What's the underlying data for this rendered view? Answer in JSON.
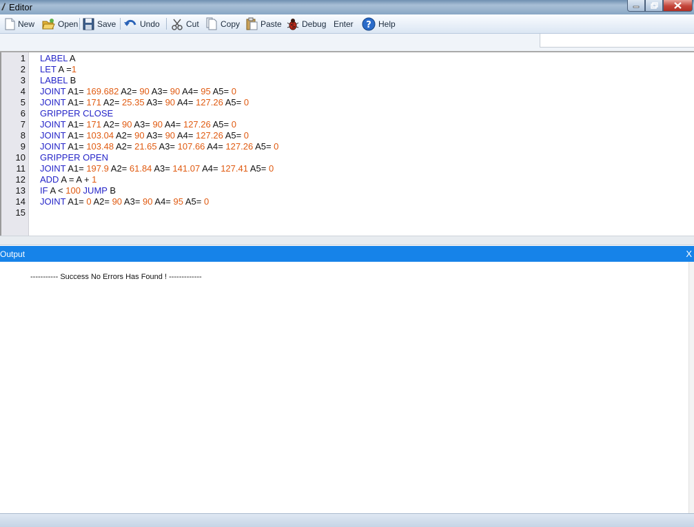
{
  "window": {
    "title": "Editor"
  },
  "toolbar": {
    "new": "New",
    "open": "Open",
    "save": "Save",
    "undo": "Undo",
    "cut": "Cut",
    "copy": "Copy",
    "paste": "Paste",
    "debug": "Debug",
    "enter": "Enter",
    "help": "Help"
  },
  "colors": {
    "keyword": "#2424c8",
    "number": "#e05a10",
    "output_header": "#1683e9"
  },
  "editor": {
    "lines": [
      [
        [
          "kw",
          "LABEL "
        ],
        [
          "t",
          "A"
        ]
      ],
      [
        [
          "kw",
          "LET "
        ],
        [
          "t",
          "A ="
        ],
        [
          "num",
          "1"
        ]
      ],
      [
        [
          "kw",
          "LABEL "
        ],
        [
          "t",
          "B"
        ]
      ],
      [
        [
          "kw",
          "JOINT "
        ],
        [
          "t",
          "A1= "
        ],
        [
          "num",
          "169.682"
        ],
        [
          "t",
          " A2= "
        ],
        [
          "num",
          "90"
        ],
        [
          "t",
          " A3= "
        ],
        [
          "num",
          "90"
        ],
        [
          "t",
          " A4= "
        ],
        [
          "num",
          "95"
        ],
        [
          "t",
          " A5= "
        ],
        [
          "num",
          "0"
        ]
      ],
      [
        [
          "kw",
          "JOINT "
        ],
        [
          "t",
          "A1= "
        ],
        [
          "num",
          "171"
        ],
        [
          "t",
          " A2= "
        ],
        [
          "num",
          "25.35"
        ],
        [
          "t",
          " A3= "
        ],
        [
          "num",
          "90"
        ],
        [
          "t",
          " A4= "
        ],
        [
          "num",
          "127.26"
        ],
        [
          "t",
          " A5= "
        ],
        [
          "num",
          "0"
        ]
      ],
      [
        [
          "kw",
          "GRIPPER CLOSE"
        ]
      ],
      [
        [
          "kw",
          "JOINT "
        ],
        [
          "t",
          "A1= "
        ],
        [
          "num",
          "171"
        ],
        [
          "t",
          " A2= "
        ],
        [
          "num",
          "90"
        ],
        [
          "t",
          " A3= "
        ],
        [
          "num",
          "90"
        ],
        [
          "t",
          " A4= "
        ],
        [
          "num",
          "127.26"
        ],
        [
          "t",
          " A5= "
        ],
        [
          "num",
          "0"
        ]
      ],
      [
        [
          "kw",
          "JOINT "
        ],
        [
          "t",
          "A1= "
        ],
        [
          "num",
          "103.04"
        ],
        [
          "t",
          " A2= "
        ],
        [
          "num",
          "90"
        ],
        [
          "t",
          " A3= "
        ],
        [
          "num",
          "90"
        ],
        [
          "t",
          " A4= "
        ],
        [
          "num",
          "127.26"
        ],
        [
          "t",
          " A5= "
        ],
        [
          "num",
          "0"
        ]
      ],
      [
        [
          "kw",
          "JOINT "
        ],
        [
          "t",
          "A1= "
        ],
        [
          "num",
          "103.48"
        ],
        [
          "t",
          " A2= "
        ],
        [
          "num",
          "21.65"
        ],
        [
          "t",
          " A3= "
        ],
        [
          "num",
          "107.66"
        ],
        [
          "t",
          " A4= "
        ],
        [
          "num",
          "127.26"
        ],
        [
          "t",
          " A5= "
        ],
        [
          "num",
          "0"
        ]
      ],
      [
        [
          "kw",
          "GRIPPER OPEN"
        ]
      ],
      [
        [
          "kw",
          "JOINT "
        ],
        [
          "t",
          "A1= "
        ],
        [
          "num",
          "197.9"
        ],
        [
          "t",
          " A2= "
        ],
        [
          "num",
          "61.84"
        ],
        [
          "t",
          " A3= "
        ],
        [
          "num",
          "141.07"
        ],
        [
          "t",
          " A4= "
        ],
        [
          "num",
          "127.41"
        ],
        [
          "t",
          " A5= "
        ],
        [
          "num",
          "0"
        ]
      ],
      [
        [
          "kw",
          "ADD "
        ],
        [
          "t",
          "A = A + "
        ],
        [
          "num",
          "1"
        ]
      ],
      [
        [
          "kw",
          "IF "
        ],
        [
          "t",
          "A < "
        ],
        [
          "num",
          "100"
        ],
        [
          "kw",
          " JUMP "
        ],
        [
          "t",
          "B"
        ]
      ],
      [
        [
          "kw",
          "JOINT "
        ],
        [
          "t",
          "A1= "
        ],
        [
          "num",
          "0"
        ],
        [
          "t",
          " A2= "
        ],
        [
          "num",
          "90"
        ],
        [
          "t",
          " A3= "
        ],
        [
          "num",
          "90"
        ],
        [
          "t",
          " A4= "
        ],
        [
          "num",
          "95"
        ],
        [
          "t",
          " A5= "
        ],
        [
          "num",
          "0"
        ]
      ],
      []
    ]
  },
  "output": {
    "title": "Output",
    "close": "X",
    "message": "----------- Success No Errors Has Found ! -------------"
  }
}
